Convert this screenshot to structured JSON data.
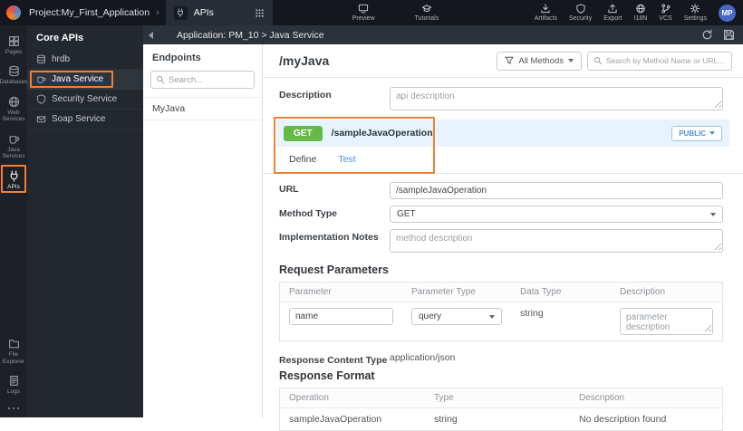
{
  "colors": {
    "annotation_orange": "#ee8134",
    "get_method_green": "#63ba45",
    "accent_blue": "#4a90d9"
  },
  "topbar": {
    "project": "Project:My_First_Application",
    "chevron": "›",
    "apis_tab_label": "APIs",
    "preview_label": "Preview",
    "tutorials_label": "Tutorials",
    "actions": [
      {
        "label": "Artifacts",
        "icon": "artifacts-download-icon"
      },
      {
        "label": "Security",
        "icon": "security-shield-icon"
      },
      {
        "label": "Export",
        "icon": "export-icon"
      },
      {
        "label": "I18N",
        "icon": "i18n-globe-icon"
      },
      {
        "label": "VCS",
        "icon": "vcs-branch-icon"
      },
      {
        "label": "Settings",
        "icon": "settings-gear-icon"
      }
    ],
    "avatar_initials": "MP"
  },
  "icon_sidebar": {
    "items": [
      {
        "label": "Pages",
        "icon": "pages-icon"
      },
      {
        "label": "Databases",
        "icon": "database-icon"
      },
      {
        "label": "Web Services",
        "icon": "web-services-globe-icon"
      },
      {
        "label": "Java Services",
        "icon": "java-coffee-icon"
      },
      {
        "label": "APIs",
        "icon": "apis-plug-icon",
        "highlighted": true
      }
    ],
    "bottom_items": [
      {
        "label": "File Explorer",
        "icon": "file-explorer-folder-icon"
      },
      {
        "label": "Logs",
        "icon": "logs-document-icon"
      }
    ]
  },
  "core_apis": {
    "title": "Core APIs",
    "items": [
      {
        "label": "hrdb",
        "icon": "database-icon"
      },
      {
        "label": "Java Service",
        "icon": "java-coffee-icon",
        "highlighted": true,
        "selected": true
      },
      {
        "label": "Security Service",
        "icon": "shield-icon"
      },
      {
        "label": "Soap Service",
        "icon": "envelope-icon"
      }
    ]
  },
  "app_header": {
    "breadcrumb": "Application: PM_10 > Java Service"
  },
  "endpoints": {
    "title": "Endpoints",
    "search_placeholder": "Search...",
    "items": [
      {
        "label": "MyJava",
        "selected": true
      }
    ]
  },
  "main": {
    "title": "/myJava",
    "methods_filter_label": "All Methods",
    "search_placeholder": "Search by Method Name or URL...",
    "description_label": "Description",
    "description_placeholder": "api description",
    "operation": {
      "method": "GET",
      "path": "/sampleJavaOperation",
      "visibility_label": "PUBLIC",
      "tabs": [
        {
          "label": "Define",
          "active": true
        },
        {
          "label": "Test"
        }
      ]
    },
    "url_label": "URL",
    "url_value": "/sampleJavaOperation",
    "method_type_label": "Method Type",
    "method_type_value": "GET",
    "impl_notes_label": "Implementation Notes",
    "impl_notes_placeholder": "method description",
    "request_parameters": {
      "title": "Request Parameters",
      "headers": [
        "Parameter",
        "Parameter Type",
        "Data Type",
        "Description"
      ],
      "row": {
        "parameter_value": "name",
        "parameter_type_value": "query",
        "data_type": "string",
        "description_placeholder": "parameter description"
      }
    },
    "response_content_type_label": "Response Content Type",
    "response_content_type_value": "application/json",
    "response_format": {
      "title": "Response Format",
      "headers": [
        "Operation",
        "Type",
        "Description"
      ],
      "rows": [
        {
          "operation": "sampleJavaOperation",
          "type": "string",
          "description": "No description found"
        }
      ]
    }
  }
}
